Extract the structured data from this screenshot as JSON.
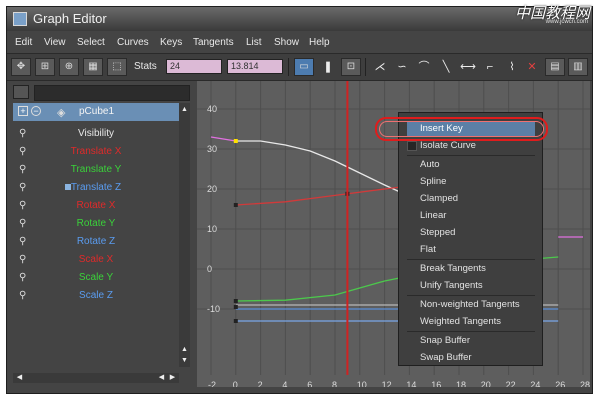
{
  "window": {
    "title": "Graph Editor"
  },
  "watermark": {
    "text": "中国教程网",
    "sub": "www.jcwcn.com"
  },
  "menubar": [
    "Edit",
    "View",
    "Select",
    "Curves",
    "Keys",
    "Tangents",
    "List",
    "Show",
    "Help"
  ],
  "toolbar": {
    "stats_label": "Stats",
    "stat1": "24",
    "stat2": "13.814"
  },
  "outliner": {
    "object": "pCube1",
    "channels": [
      {
        "label": "Visibility",
        "color": "#e8e8e8"
      },
      {
        "label": "Translate X",
        "color": "#e02a2a"
      },
      {
        "label": "Translate Y",
        "color": "#3ad23a"
      },
      {
        "label": "Translate Z",
        "color": "#5a9cf0"
      },
      {
        "label": "Rotate X",
        "color": "#e02a2a"
      },
      {
        "label": "Rotate Y",
        "color": "#3ad23a"
      },
      {
        "label": "Rotate Z",
        "color": "#5a9cf0"
      },
      {
        "label": "Scale X",
        "color": "#e02a2a"
      },
      {
        "label": "Scale Y",
        "color": "#3ad23a"
      },
      {
        "label": "Scale Z",
        "color": "#5a9cf0"
      }
    ]
  },
  "graph": {
    "y_ticks": [
      "40",
      "30",
      "20",
      "10",
      "0",
      "-10"
    ],
    "x_ticks": [
      "-2",
      "0",
      "2",
      "4",
      "6",
      "8",
      "10",
      "12",
      "14",
      "16",
      "18",
      "20",
      "22",
      "24",
      "26",
      "28"
    ],
    "current_frame": 9
  },
  "context_menu": {
    "items": [
      "Insert Key",
      "Isolate Curve",
      "Auto",
      "Spline",
      "Clamped",
      "Linear",
      "Stepped",
      "Flat",
      "Break Tangents",
      "Unify Tangents",
      "Non-weighted Tangents",
      "Weighted Tangents",
      "Snap Buffer",
      "Swap Buffer"
    ],
    "highlighted": "Insert Key"
  }
}
